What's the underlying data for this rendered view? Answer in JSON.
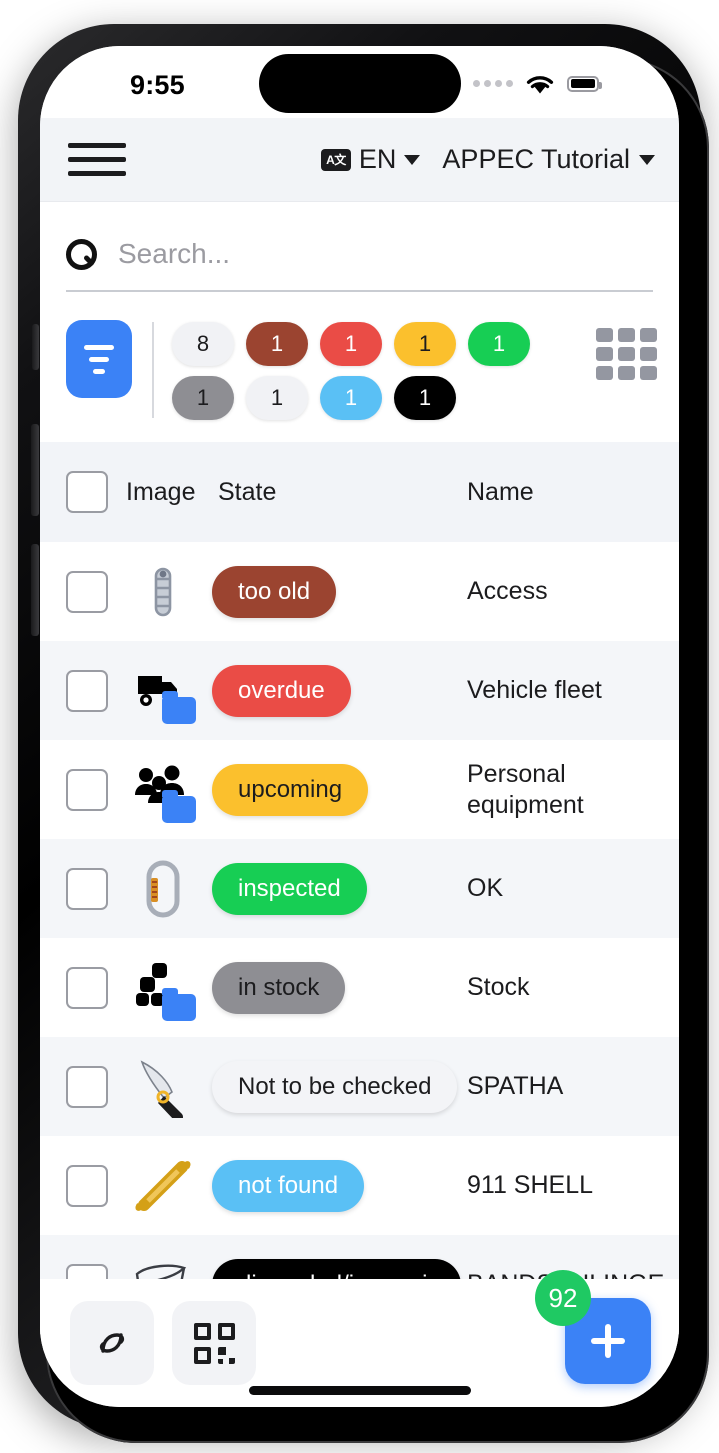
{
  "status_bar": {
    "time": "9:55",
    "cellular_icon": "cellular-dots-icon",
    "wifi_icon": "wifi-icon",
    "battery_icon": "battery-full-icon"
  },
  "app_bar": {
    "menu_icon": "hamburger-menu-icon",
    "language_badge": "A文",
    "language_label": "EN",
    "language_chevron": "chevron-down-icon",
    "project_label": "APPEC Tutorial",
    "project_chevron": "chevron-down-icon"
  },
  "search": {
    "icon": "search-icon",
    "placeholder": "Search...",
    "value": ""
  },
  "toolbar": {
    "filter_icon": "filter-icon",
    "grid_view_icon": "grid-view-icon",
    "chips": [
      {
        "count": "8",
        "bg": "#f1f2f5",
        "fg": "#1c1c1e",
        "name": "filter-chip-all"
      },
      {
        "count": "1",
        "bg": "#9b4430",
        "fg": "#ffffff",
        "name": "filter-chip-too-old"
      },
      {
        "count": "1",
        "bg": "#ea4c46",
        "fg": "#ffffff",
        "name": "filter-chip-overdue"
      },
      {
        "count": "1",
        "bg": "#fbc02d",
        "fg": "#1c1c1e",
        "name": "filter-chip-upcoming"
      },
      {
        "count": "1",
        "bg": "#17ce54",
        "fg": "#ffffff",
        "name": "filter-chip-inspected"
      },
      {
        "count": "1",
        "bg": "#8e8e93",
        "fg": "#1c1c1e",
        "name": "filter-chip-in-stock"
      },
      {
        "count": "1",
        "bg": "#f1f2f5",
        "fg": "#1c1c1e",
        "name": "filter-chip-not-to-be-checked"
      },
      {
        "count": "1",
        "bg": "#5ac0f5",
        "fg": "#ffffff",
        "name": "filter-chip-not-found"
      },
      {
        "count": "1",
        "bg": "#000000",
        "fg": "#ffffff",
        "name": "filter-chip-discarded"
      }
    ]
  },
  "table": {
    "columns": {
      "image": "Image",
      "state": "State",
      "name": "Name"
    },
    "select_all_checkbox": false,
    "rows": [
      {
        "icon": "rope-icon",
        "state": "too old",
        "state_bg": "#9b4430",
        "state_fg": "#ffffff",
        "name": "Access",
        "checked": false
      },
      {
        "icon": "truck-folder-icon",
        "state": "overdue",
        "state_bg": "#ea4c46",
        "state_fg": "#ffffff",
        "name": "Vehicle fleet",
        "checked": false
      },
      {
        "icon": "people-folder-icon",
        "state": "upcoming",
        "state_bg": "#fbc02d",
        "state_fg": "#1c1c1e",
        "name": "Personal equipment",
        "checked": false
      },
      {
        "icon": "carabiner-icon",
        "state": "inspected",
        "state_bg": "#17ce54",
        "state_fg": "#ffffff",
        "name": "OK",
        "checked": false
      },
      {
        "icon": "boxes-folder-icon",
        "state": "in stock",
        "state_bg": "#8e8e93",
        "state_fg": "#1c1c1e",
        "name": "Stock",
        "checked": false
      },
      {
        "icon": "knife-icon",
        "state": "Not to be checked",
        "state_bg": "#f3f4f7",
        "state_fg": "#1c1c1e",
        "name": "SPATHA",
        "checked": false
      },
      {
        "icon": "shell-tool-icon",
        "state": "not found",
        "state_bg": "#5ac0f5",
        "state_fg": "#ffffff",
        "name": "911 SHELL",
        "checked": false
      },
      {
        "icon": "sling-icon",
        "state": "discarded/in repair",
        "state_bg": "#000000",
        "state_fg": "#ffffff",
        "name": "BANDSCHLINGE",
        "checked": false
      }
    ]
  },
  "bottom_bar": {
    "nfc_icon": "nfc-icon",
    "qr_icon": "qr-code-scan-icon",
    "add_icon": "plus-icon",
    "count_badge": "92"
  },
  "colors": {
    "accent": "#3b82f6",
    "badge_green": "#1fc963",
    "appbar_bg": "#f2f4f7",
    "row_alt_bg": "#f4f6f9"
  }
}
